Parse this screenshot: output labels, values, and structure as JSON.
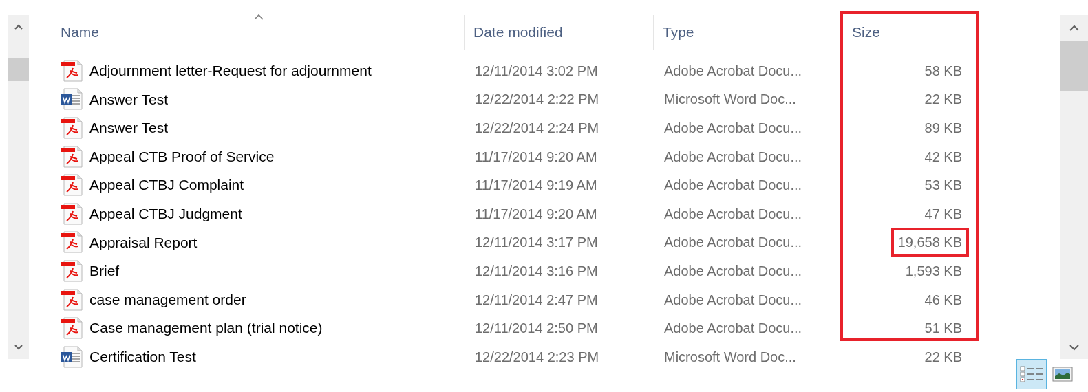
{
  "columns": [
    {
      "label": "Name",
      "sorted": true
    },
    {
      "label": "Date modified"
    },
    {
      "label": "Type"
    },
    {
      "label": "Size",
      "highlighted": true
    }
  ],
  "rows": [
    {
      "kind": "pdf",
      "name": "Adjournment letter-Request for adjournment",
      "date": "12/11/2014 3:02 PM",
      "type": "Adobe Acrobat Docu...",
      "size": "58 KB"
    },
    {
      "kind": "word",
      "name": "Answer Test",
      "date": "12/22/2014 2:22 PM",
      "type": "Microsoft Word Doc...",
      "size": "22 KB"
    },
    {
      "kind": "pdf",
      "name": "Answer Test",
      "date": "12/22/2014 2:24 PM",
      "type": "Adobe Acrobat Docu...",
      "size": "89 KB"
    },
    {
      "kind": "pdf",
      "name": "Appeal CTB Proof of Service",
      "date": "11/17/2014 9:20 AM",
      "type": "Adobe Acrobat Docu...",
      "size": "42 KB"
    },
    {
      "kind": "pdf",
      "name": "Appeal CTBJ Complaint",
      "date": "11/17/2014 9:19 AM",
      "type": "Adobe Acrobat Docu...",
      "size": "53 KB"
    },
    {
      "kind": "pdf",
      "name": "Appeal CTBJ Judgment",
      "date": "11/17/2014 9:20 AM",
      "type": "Adobe Acrobat Docu...",
      "size": "47 KB"
    },
    {
      "kind": "pdf",
      "name": "Appraisal Report",
      "date": "12/11/2014 3:17 PM",
      "type": "Adobe Acrobat Docu...",
      "size": "19,658 KB",
      "highlighted": true
    },
    {
      "kind": "pdf",
      "name": "Brief",
      "date": "12/11/2014 3:16 PM",
      "type": "Adobe Acrobat Docu...",
      "size": "1,593 KB"
    },
    {
      "kind": "pdf",
      "name": "case management order",
      "date": "12/11/2014 2:47 PM",
      "type": "Adobe Acrobat Docu...",
      "size": "46 KB"
    },
    {
      "kind": "pdf",
      "name": "Case management plan (trial notice)",
      "date": "12/11/2014 2:50 PM",
      "type": "Adobe Acrobat Docu...",
      "size": "51 KB"
    },
    {
      "kind": "word",
      "name": "Certification Test",
      "date": "12/22/2014 2:23 PM",
      "type": "Microsoft Word Doc...",
      "size": "22 KB"
    }
  ],
  "view_buttons": [
    {
      "kind": "details",
      "selected": true
    },
    {
      "kind": "large_icons",
      "selected": false
    }
  ]
}
